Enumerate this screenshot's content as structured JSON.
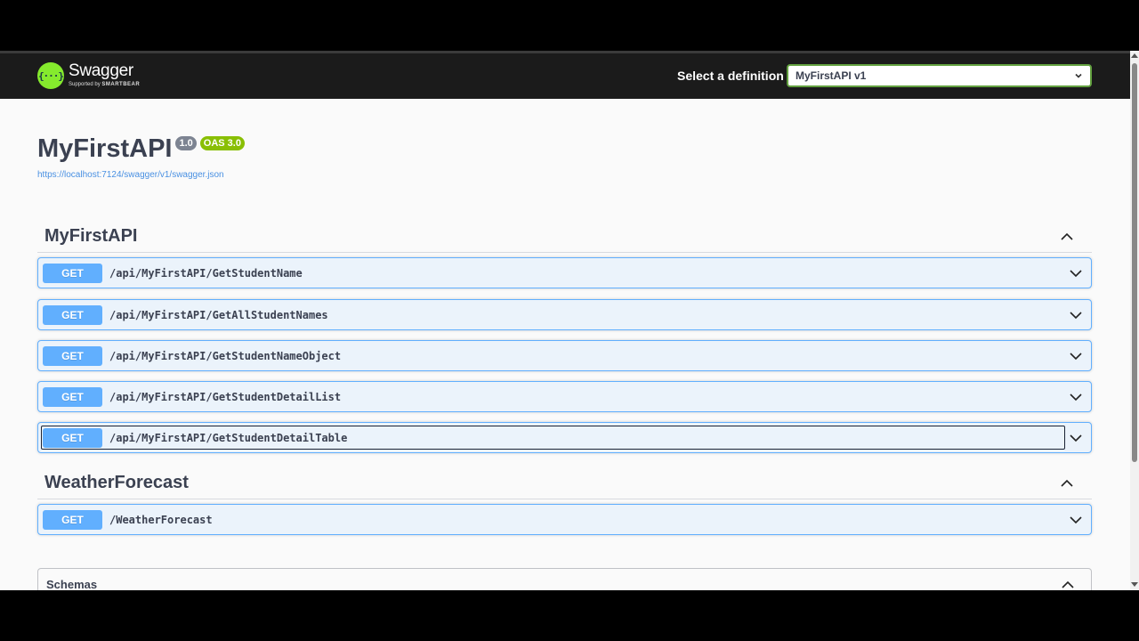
{
  "header": {
    "brand": "Swagger",
    "brand_sub_prefix": "Supported by",
    "brand_sub_name": "SMARTBEAR",
    "definition_label": "Select a definition",
    "definition_value": "MyFirstAPI v1"
  },
  "info": {
    "title": "MyFirstAPI",
    "version": "1.0",
    "oas": "OAS 3.0",
    "url": "https://localhost:7124/swagger/v1/swagger.json"
  },
  "sections": [
    {
      "title": "MyFirstAPI",
      "operations": [
        {
          "method": "GET",
          "path": "/api/MyFirstAPI/GetStudentName"
        },
        {
          "method": "GET",
          "path": "/api/MyFirstAPI/GetAllStudentNames"
        },
        {
          "method": "GET",
          "path": "/api/MyFirstAPI/GetStudentNameObject"
        },
        {
          "method": "GET",
          "path": "/api/MyFirstAPI/GetStudentDetailList"
        },
        {
          "method": "GET",
          "path": "/api/MyFirstAPI/GetStudentDetailTable"
        }
      ]
    },
    {
      "title": "WeatherForecast",
      "operations": [
        {
          "method": "GET",
          "path": "/WeatherForecast"
        }
      ]
    }
  ],
  "schemas": {
    "title": "Schemas"
  },
  "colors": {
    "get": "#61affe",
    "get_bg": "#ebf3fb",
    "swagger_green": "#85ea2d",
    "oas_badge": "#89bf04",
    "version_badge": "#7d8492",
    "link": "#4990e2"
  },
  "icons": [
    "swagger-logo-icon",
    "chevron-down-icon",
    "chevron-up-icon"
  ]
}
